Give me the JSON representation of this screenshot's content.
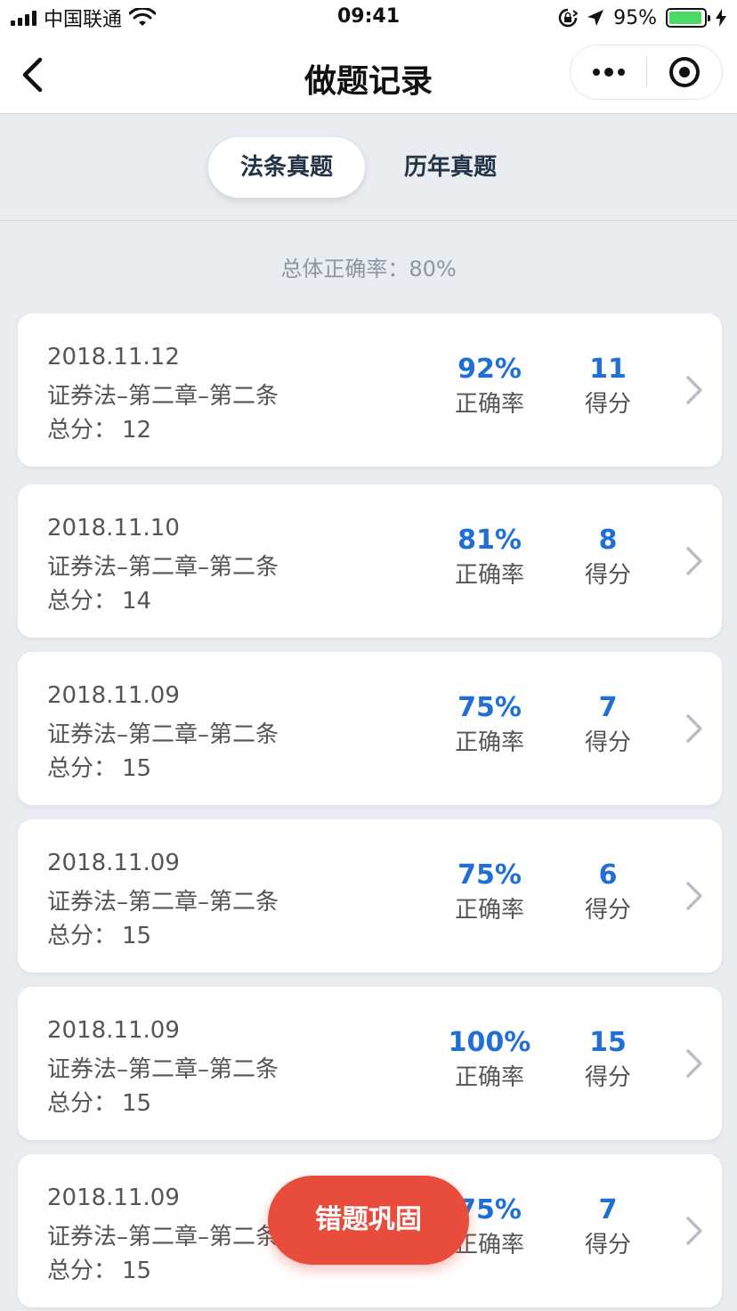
{
  "status_bar": {
    "carrier": "中国联通",
    "time": "09:41",
    "battery": "95%",
    "battery_level": 0.95
  },
  "nav": {
    "title": "做题记录"
  },
  "tabs": [
    {
      "label": "法条真题",
      "active": true
    },
    {
      "label": "历年真题",
      "active": false
    }
  ],
  "summary": {
    "label": "总体正确率：",
    "value": "80%"
  },
  "records": [
    {
      "date": "2018.11.12",
      "title": "证券法–第二章–第二条",
      "total_label": "总分：",
      "total": "12",
      "accuracy": "92%",
      "accuracy_label": "正确率",
      "score": "11",
      "score_label": "得分"
    },
    {
      "date": "2018.11.10",
      "title": "证券法–第二章–第二条",
      "total_label": "总分：",
      "total": "14",
      "accuracy": "81%",
      "accuracy_label": "正确率",
      "score": "8",
      "score_label": "得分"
    },
    {
      "date": "2018.11.09",
      "title": "证券法–第二章–第二条",
      "total_label": "总分：",
      "total": "15",
      "accuracy": "75%",
      "accuracy_label": "正确率",
      "score": "7",
      "score_label": "得分"
    },
    {
      "date": "2018.11.09",
      "title": "证券法–第二章–第二条",
      "total_label": "总分：",
      "total": "15",
      "accuracy": "75%",
      "accuracy_label": "正确率",
      "score": "6",
      "score_label": "得分"
    },
    {
      "date": "2018.11.09",
      "title": "证券法–第二章–第二条",
      "total_label": "总分：",
      "total": "15",
      "accuracy": "100%",
      "accuracy_label": "正确率",
      "score": "15",
      "score_label": "得分"
    },
    {
      "date": "2018.11.09",
      "title": "证券法–第二章–第二条",
      "total_label": "总分：",
      "total": "15",
      "accuracy": "75%",
      "accuracy_label": "正确率",
      "score": "7",
      "score_label": "得分"
    }
  ],
  "fab": {
    "label": "错题巩固"
  },
  "colors": {
    "accent_blue": "#1f6fd6",
    "fab_red": "#e74c3c",
    "background": "#e9ecf0"
  }
}
